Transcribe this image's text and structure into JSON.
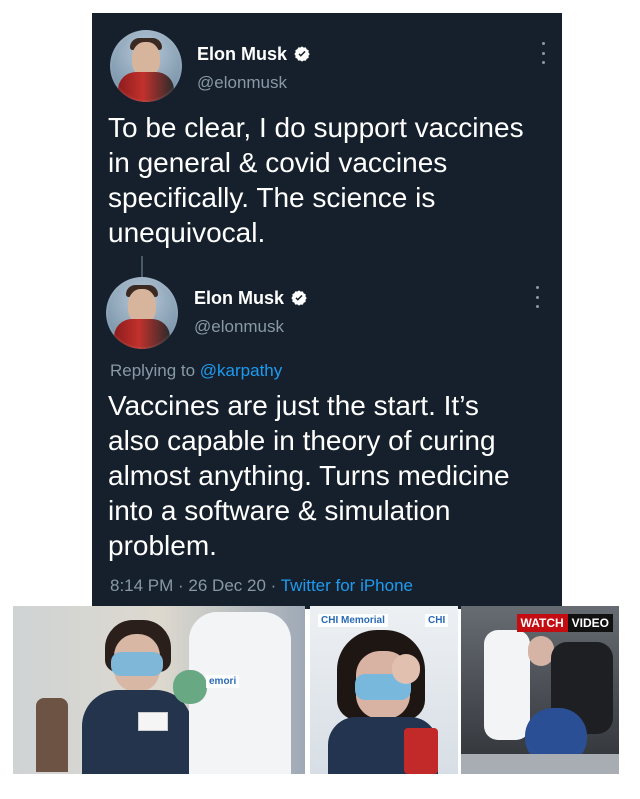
{
  "tweet_1": {
    "name": "Elon Musk",
    "handle": "@elonmusk",
    "text_lines": [
      "To be clear, I do support vaccines",
      "in general & covid vaccines",
      "specifically. The science is",
      "unequivocal."
    ]
  },
  "tweet_2": {
    "name": "Elon Musk",
    "handle": "@elonmusk",
    "replying_prefix": "Replying to ",
    "replying_to": "@karpathy",
    "text_lines": [
      "Vaccines are just the start. It’s",
      "also capable in theory of curing",
      "almost anything. Turns medicine",
      "into a software & simulation",
      "problem."
    ],
    "timestamp": "8:14 PM · 26 Dec 20 · ",
    "source": "Twitter for iPhone"
  },
  "photos": {
    "left_sign": "emori",
    "middle_sign_left": "CHI Memorial",
    "middle_sign_right": "CHI",
    "watch_label": "WATCH",
    "video_label": "VIDEO"
  },
  "colors": {
    "card_bg": "#16202c",
    "text_primary": "#ffffff",
    "text_secondary": "#8899a6",
    "accent": "#1d9bf0",
    "watch_red": "#c40d12"
  }
}
